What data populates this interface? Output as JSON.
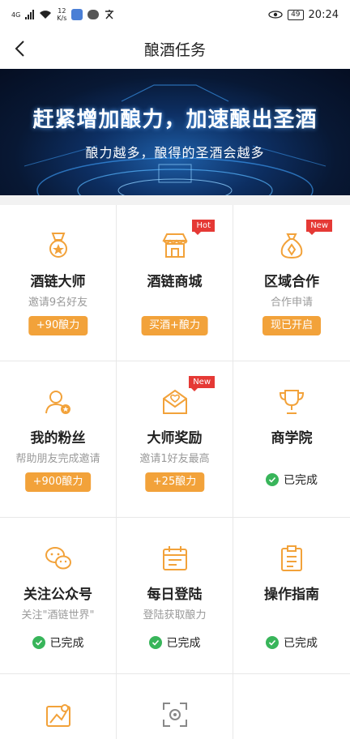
{
  "status_bar": {
    "network": "4G",
    "speed_value": "12",
    "speed_unit": "K/s",
    "battery": "49",
    "time": "20:24"
  },
  "nav": {
    "title": "酿酒任务"
  },
  "banner": {
    "title": "赶紧增加酿力，加速酿出圣酒",
    "subtitle": "酿力越多，酿得的圣酒会越多"
  },
  "accent_color": "#f2a23a",
  "tasks": [
    {
      "title": "酒链大师",
      "desc": "邀请9名好友",
      "button": "+90酿力",
      "icon": "medal-icon"
    },
    {
      "title": "酒链商城",
      "desc": "",
      "button": "买酒+酿力",
      "badge": "Hot",
      "icon": "store-icon"
    },
    {
      "title": "区域合作",
      "desc": "合作申请",
      "button": "现已开启",
      "badge": "New",
      "icon": "money-bag-icon"
    },
    {
      "title": "我的粉丝",
      "desc": "帮助朋友完成邀请",
      "button": "+900酿力",
      "icon": "fans-icon"
    },
    {
      "title": "大师奖励",
      "desc": "邀请1好友最高",
      "button": "+25酿力",
      "badge": "New",
      "icon": "envelope-icon"
    },
    {
      "title": "商学院",
      "status": "已完成",
      "icon": "trophy-icon"
    },
    {
      "title": "关注公众号",
      "desc": "关注\"酒链世界\"",
      "status": "已完成",
      "icon": "wechat-icon"
    },
    {
      "title": "每日登陆",
      "desc": "登陆获取酿力",
      "status": "已完成",
      "icon": "calendar-icon"
    },
    {
      "title": "操作指南",
      "status": "已完成",
      "icon": "clipboard-icon"
    },
    {
      "icon": "map-icon"
    },
    {
      "icon": "scan-icon"
    },
    {}
  ]
}
